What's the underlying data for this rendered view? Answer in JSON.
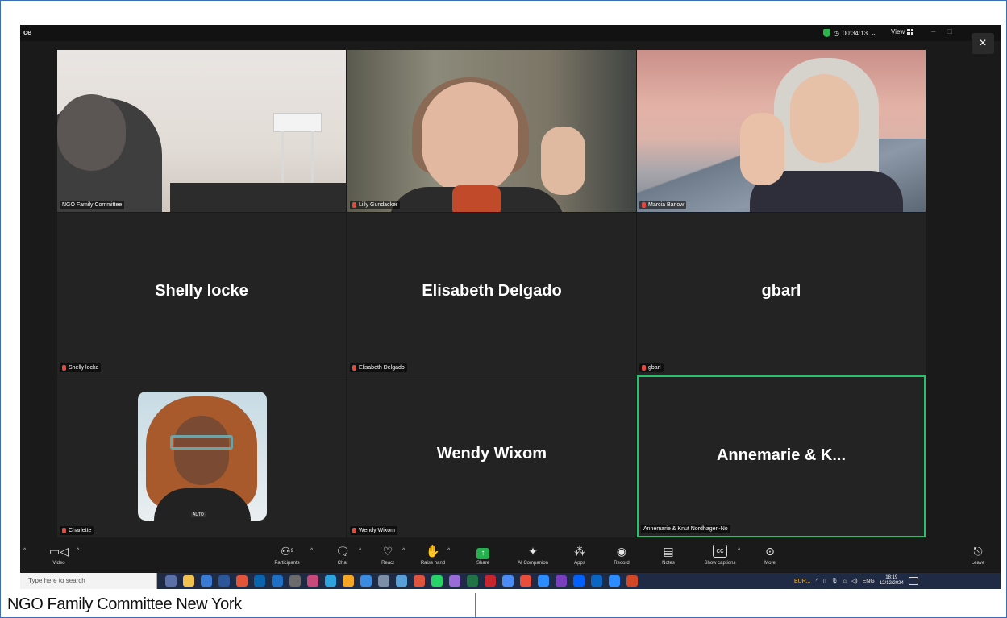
{
  "window": {
    "title_fragment": "ce",
    "timer": "00:34:13",
    "view_label": "View",
    "close_symbol": "×",
    "colors": {
      "background": "#1a1a1a",
      "active_speaker": "#25c46a",
      "muted": "#e04a3f",
      "share": "#22b14c"
    }
  },
  "tiles": [
    {
      "label": "NGO Family Committee",
      "big_name": "",
      "muted": false
    },
    {
      "label": "Lilly Gundacker",
      "big_name": "",
      "muted": true
    },
    {
      "label": "Marcia Barlow",
      "big_name": "",
      "muted": true
    },
    {
      "label": "Shelly locke",
      "big_name": "Shelly locke",
      "muted": true
    },
    {
      "label": "Elisabeth Delgado",
      "big_name": "Elisabeth Delgado",
      "muted": true
    },
    {
      "label": "gbarl",
      "big_name": "gbarl",
      "muted": true
    },
    {
      "label": "Charlette",
      "big_name": "",
      "muted": true,
      "badge": "AUTO"
    },
    {
      "label": "Wendy Wixom",
      "big_name": "Wendy Wixom",
      "muted": true
    },
    {
      "label": "Annemarie & Knut Nordhagen-No",
      "big_name": "Annemarie & K...",
      "muted": false,
      "active": true
    }
  ],
  "toolbar": {
    "video": "Video",
    "participants": "Participants",
    "participants_count": "9",
    "chat": "Chat",
    "react": "React",
    "raise_hand": "Raise hand",
    "share": "Share",
    "ai_companion": "AI Companion",
    "apps": "Apps",
    "record": "Record",
    "notes": "Notes",
    "show_captions": "Show captions",
    "more": "More",
    "leave": "Leave"
  },
  "taskbar": {
    "search_placeholder": "Type here to search",
    "currency": "EUR...",
    "language": "ENG",
    "time": "18:19",
    "date": "12/12/2024",
    "badge_count": "24"
  },
  "caption": "NGO Family Committee New York"
}
